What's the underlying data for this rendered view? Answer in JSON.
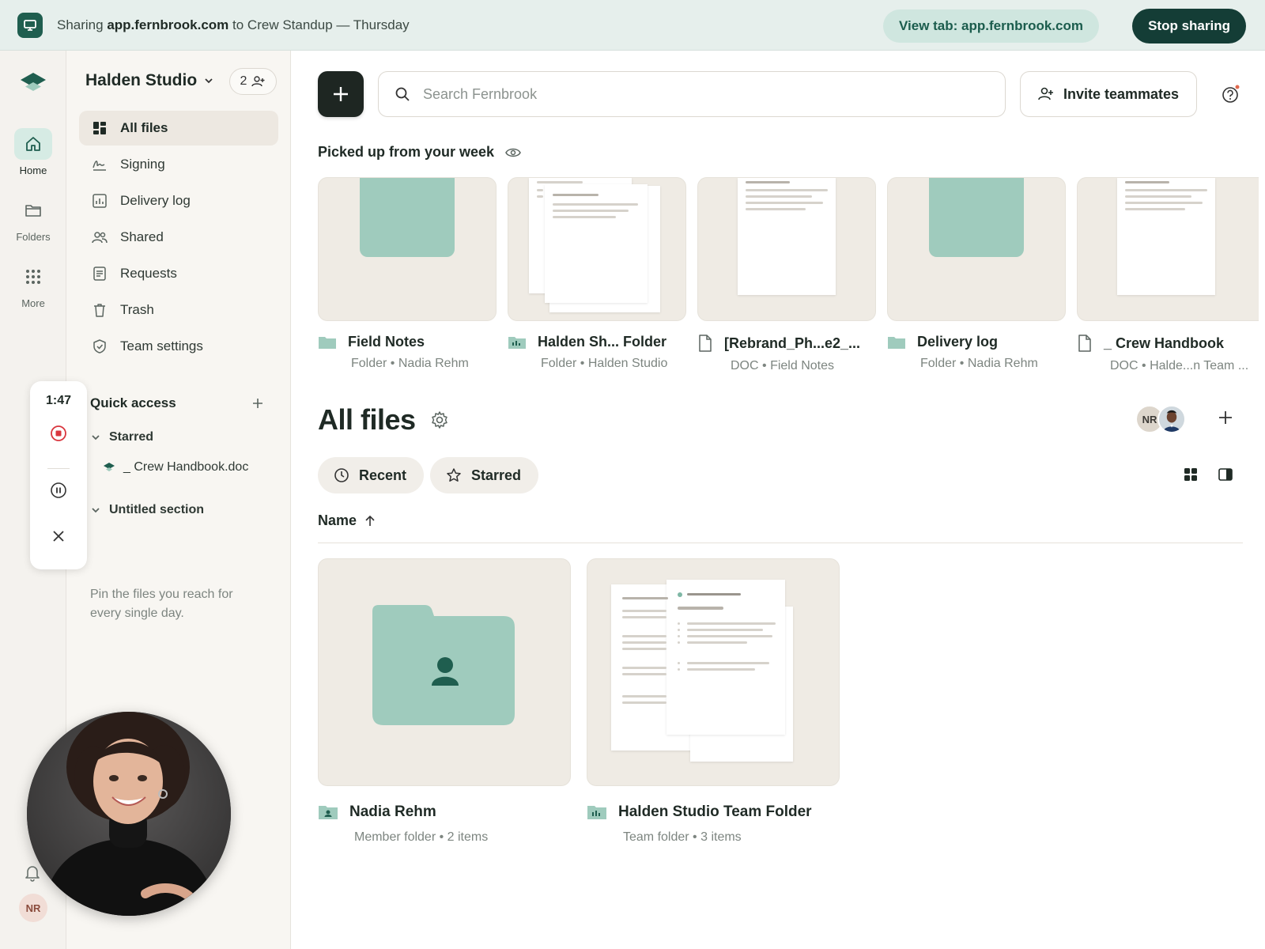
{
  "sharebar": {
    "prefix": "Sharing ",
    "domain": "app.fernbrook.com",
    "suffix": " to Crew Standup — Thursday",
    "view_tab": "View tab: app.fernbrook.com",
    "stop": "Stop sharing"
  },
  "rail": {
    "items": [
      {
        "label": "Home",
        "icon": "home-icon"
      },
      {
        "label": "Folders",
        "icon": "folder-icon"
      },
      {
        "label": "More",
        "icon": "grid-dots-icon"
      }
    ],
    "avatar": "NR"
  },
  "sidebar": {
    "workspace": "Halden Studio",
    "member_count": "2",
    "nav": [
      {
        "label": "All files",
        "icon": "all-files-icon"
      },
      {
        "label": "Signing",
        "icon": "signature-icon"
      },
      {
        "label": "Delivery log",
        "icon": "chart-icon"
      },
      {
        "label": "Shared",
        "icon": "people-icon"
      },
      {
        "label": "Requests",
        "icon": "request-icon"
      },
      {
        "label": "Trash",
        "icon": "trash-icon"
      },
      {
        "label": "Team settings",
        "icon": "shield-icon"
      }
    ],
    "quick_access": {
      "title": "Quick access",
      "starred": "Starred",
      "starred_file": "_ Crew Handbook.doc",
      "untitled": "Untitled section",
      "hint": "Pin the files you reach for every single day."
    }
  },
  "recording": {
    "time": "1:47"
  },
  "main": {
    "search_placeholder": "Search Fernbrook",
    "invite": "Invite teammates",
    "picked_title": "Picked up from your week",
    "picked": [
      {
        "name": "Field Notes",
        "type": "Folder",
        "owner": "Nadia Rehm",
        "kind": "folder"
      },
      {
        "name": "Halden Sh... Folder",
        "type": "Folder",
        "owner": "Halden Studio",
        "kind": "team-doc"
      },
      {
        "name": "[Rebrand_Ph...e2_...",
        "type": "DOC",
        "owner": "Field Notes",
        "kind": "doc"
      },
      {
        "name": "Delivery log",
        "type": "Folder",
        "owner": "Nadia Rehm",
        "kind": "folder"
      },
      {
        "name": "_ Crew Handbook",
        "type": "DOC",
        "owner": "Halde...n Team ...",
        "kind": "doc"
      }
    ],
    "all_files_title": "All files",
    "avatars": [
      "NR"
    ],
    "chips": [
      "Recent",
      "Starred"
    ],
    "sort_label": "Name",
    "files": [
      {
        "name": "Nadia Rehm",
        "meta_type": "Member folder",
        "meta_count": "2 items"
      },
      {
        "name": "Halden Studio Team Folder",
        "meta_type": "Team folder",
        "meta_count": "3 items"
      }
    ],
    "colors": {
      "accent": "#9fcbbd",
      "accent_dark": "#1f5e4f",
      "stop": "#143d36"
    }
  }
}
